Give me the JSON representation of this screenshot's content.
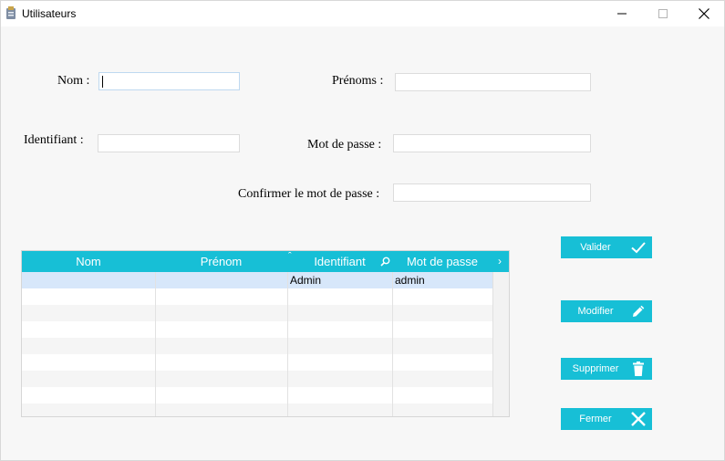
{
  "window": {
    "title": "Utilisateurs"
  },
  "form": {
    "nom_label": "Nom :",
    "nom_value": "",
    "prenoms_label": "Prénoms :",
    "prenoms_value": "",
    "identifiant_label": "Identifiant :",
    "identifiant_value": "",
    "mot_de_passe_label": "Mot de passe :",
    "mot_de_passe_value": "",
    "confirmer_label": "Confirmer le mot de passe :",
    "confirmer_value": ""
  },
  "table": {
    "columns": [
      "Nom",
      "Prénom",
      "Identifiant",
      "Mot de passe"
    ],
    "rows": [
      [
        "",
        "",
        "Admin",
        "admin"
      ]
    ]
  },
  "actions": {
    "valider": "Valider",
    "modifier": "Modifier",
    "supprimer": "Supprimer",
    "fermer": "Fermer"
  },
  "colors": {
    "accent": "#17bfd6",
    "selected_row": "#d7e7fa"
  }
}
